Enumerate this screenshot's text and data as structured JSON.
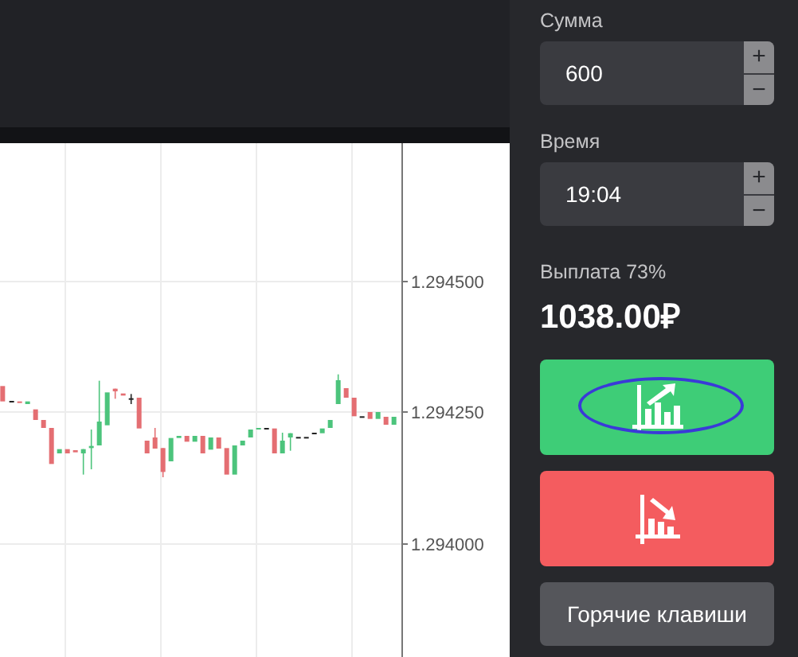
{
  "chart": {
    "price_labels": [
      "1.294500",
      "1.294250",
      "1.294000"
    ]
  },
  "panel": {
    "amount": {
      "label": "Сумма",
      "value": "600",
      "plus": "+",
      "minus": "−"
    },
    "time": {
      "label": "Время",
      "value": "19:04",
      "plus": "+",
      "minus": "−"
    },
    "payout": {
      "label": "Выплата 73%",
      "value": "1038.00₽"
    },
    "up_button": {
      "highlighted": true
    },
    "hotkeys_button": "Горячие клавиши"
  }
}
